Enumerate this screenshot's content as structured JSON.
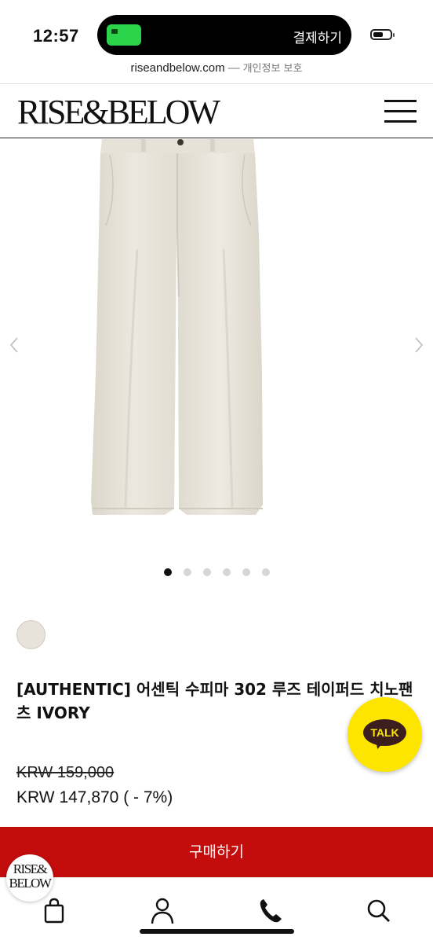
{
  "status": {
    "time": "12:57",
    "island_label": "결제하기"
  },
  "url_bar": {
    "host": "riseandbelow.com",
    "separator": "—",
    "privacy": "개인정보 보호"
  },
  "header": {
    "logo": "RISE&BELOW"
  },
  "gallery": {
    "total_images": 6,
    "active_index": 0
  },
  "product": {
    "title": "[AUTHENTIC] 어센틱 수피마 302 루즈 테이퍼드 치노팬츠 IVORY",
    "swatch_color": "#e7e3da",
    "original_price": "KRW 159,000",
    "sale_price": "KRW 147,870 ( - 7%)"
  },
  "kakao": {
    "label": "TALK"
  },
  "actions": {
    "buy_label": "구매하기"
  },
  "badge": {
    "line1": "RISE&",
    "line2": "BELOW"
  },
  "tabbar": {
    "icons": [
      "bag-icon",
      "user-icon",
      "phone-icon",
      "search-icon"
    ]
  },
  "colors": {
    "buy_button": "#c30d0d",
    "kakao": "#fee500"
  }
}
